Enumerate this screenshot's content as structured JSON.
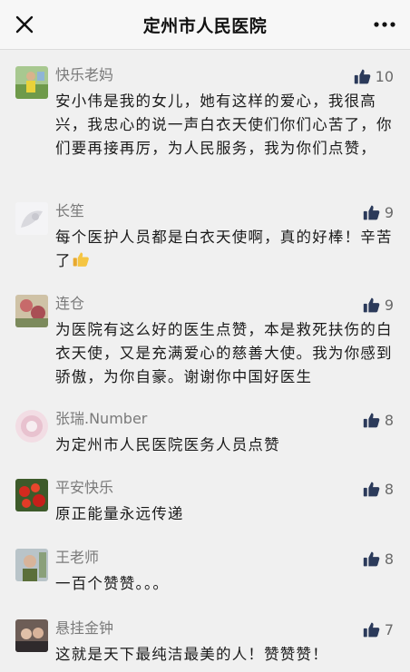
{
  "header": {
    "title": "定州市人民医院",
    "close_icon": "close-icon",
    "more_icon": "more-icon"
  },
  "comments": [
    {
      "name": "快乐老妈",
      "likes": "10",
      "text": "安小伟是我的女儿，她有这样的爱心，我很高兴，我忠心的说一声白衣天使们你们心苦了，你们要再接再厉，为人民服务，我为你们点赞，"
    },
    {
      "name": "长笙",
      "likes": "9",
      "text": "每个医护人员都是白衣天使啊，真的好棒！辛苦了",
      "emoji": "thumbs-up-emoji"
    },
    {
      "name": "连仓",
      "likes": "9",
      "text": "为医院有这么好的医生点赞，本是救死扶伤的白衣天使，又是充满爱心的慈善大使。我为你感到骄傲，为你自豪。谢谢你中国好医生"
    },
    {
      "name": "张瑞.Number",
      "likes": "8",
      "text": "为定州市人民医院医务人员点赞"
    },
    {
      "name": "平安快乐",
      "likes": "8",
      "text": "原正能量永远传递"
    },
    {
      "name": "王老师",
      "likes": "8",
      "text": "一百个赞赞。。。"
    },
    {
      "name": "悬挂金钟",
      "likes": "7",
      "text": "这就是天下最纯洁最美的人！赞赞赞！"
    }
  ],
  "colors": {
    "background": "#f0f0f0",
    "nickname": "#7a7a7a",
    "like_icon": "#2b3a5a",
    "text": "#1a1a1a"
  }
}
